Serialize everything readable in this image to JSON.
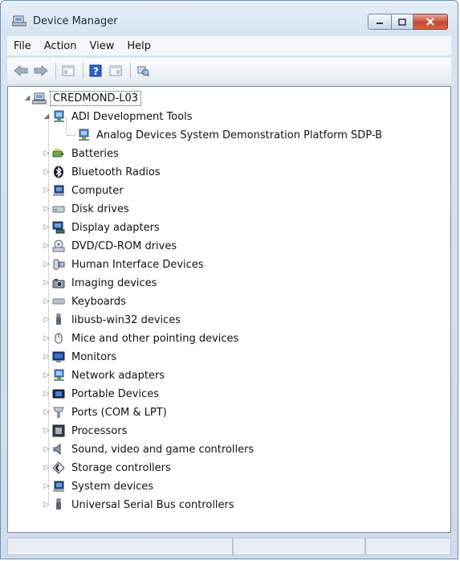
{
  "window": {
    "title": "Device Manager",
    "icon": "device-manager-icon"
  },
  "menu": [
    "File",
    "Action",
    "View",
    "Help"
  ],
  "toolbar": {
    "buttons": [
      {
        "name": "back-button",
        "icon": "back-arrow-icon"
      },
      {
        "name": "forward-button",
        "icon": "forward-arrow-icon"
      },
      {
        "name": "show-hide-console-tree-button",
        "icon": "console-tree-icon"
      },
      {
        "name": "help-button",
        "icon": "help-icon"
      },
      {
        "name": "properties-button",
        "icon": "properties-icon"
      },
      {
        "name": "scan-hardware-button",
        "icon": "scan-hardware-icon"
      }
    ]
  },
  "tree": {
    "root": {
      "label": "CREDMOND-L03",
      "icon": "computer-icon",
      "expanded": true
    },
    "categories": [
      {
        "label": "ADI Development Tools",
        "icon": "network-device-icon",
        "expanded": true,
        "children": [
          {
            "label": "Analog Devices System Demonstration Platform SDP-B",
            "icon": "network-device-icon"
          }
        ]
      },
      {
        "label": "Batteries",
        "icon": "battery-icon"
      },
      {
        "label": "Bluetooth Radios",
        "icon": "bluetooth-icon"
      },
      {
        "label": "Computer",
        "icon": "computer-icon"
      },
      {
        "label": "Disk drives",
        "icon": "disk-drive-icon"
      },
      {
        "label": "Display adapters",
        "icon": "display-adapter-icon"
      },
      {
        "label": "DVD/CD-ROM drives",
        "icon": "dvd-drive-icon"
      },
      {
        "label": "Human Interface Devices",
        "icon": "hid-icon"
      },
      {
        "label": "Imaging devices",
        "icon": "camera-icon"
      },
      {
        "label": "Keyboards",
        "icon": "keyboard-icon"
      },
      {
        "label": "libusb-win32 devices",
        "icon": "usb-plug-icon"
      },
      {
        "label": "Mice and other pointing devices",
        "icon": "mouse-icon"
      },
      {
        "label": "Monitors",
        "icon": "monitor-icon"
      },
      {
        "label": "Network adapters",
        "icon": "network-adapter-icon"
      },
      {
        "label": "Portable Devices",
        "icon": "portable-device-icon"
      },
      {
        "label": "Ports (COM & LPT)",
        "icon": "port-icon"
      },
      {
        "label": "Processors",
        "icon": "processor-icon"
      },
      {
        "label": "Sound, video and game controllers",
        "icon": "speaker-icon"
      },
      {
        "label": "Storage controllers",
        "icon": "storage-controller-icon"
      },
      {
        "label": "System devices",
        "icon": "system-devices-icon"
      },
      {
        "label": "Universal Serial Bus controllers",
        "icon": "usb-plug-icon"
      }
    ]
  },
  "colors": {
    "frame": "#cfdceb",
    "close": "#c6452d",
    "selection_border": "#444444"
  }
}
